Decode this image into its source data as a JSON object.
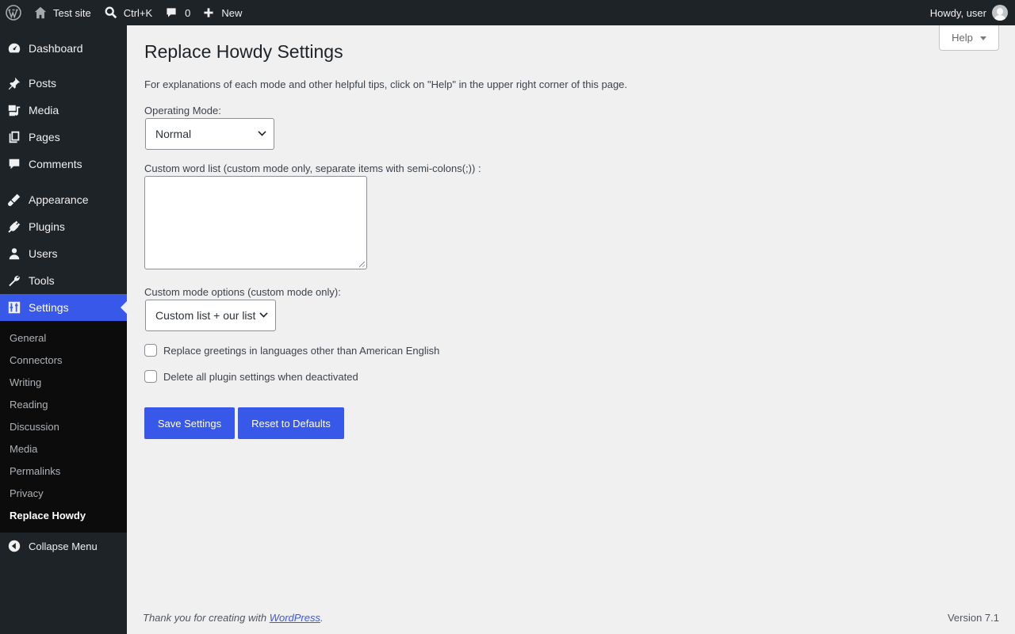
{
  "adminbar": {
    "site_name": "Test site",
    "search_shortcut": "Ctrl+K",
    "comments_count": "0",
    "new_label": "New",
    "howdy": "Howdy, user"
  },
  "sidebar": {
    "items": [
      {
        "label": "Dashboard",
        "icon": "dashboard-icon"
      },
      {
        "label": "Posts",
        "icon": "pin-icon"
      },
      {
        "label": "Media",
        "icon": "media-icon"
      },
      {
        "label": "Pages",
        "icon": "pages-icon"
      },
      {
        "label": "Comments",
        "icon": "comment-icon"
      },
      {
        "label": "Appearance",
        "icon": "brush-icon"
      },
      {
        "label": "Plugins",
        "icon": "plug-icon"
      },
      {
        "label": "Users",
        "icon": "user-icon"
      },
      {
        "label": "Tools",
        "icon": "wrench-icon"
      },
      {
        "label": "Settings",
        "icon": "settings-icon"
      }
    ],
    "submenu": [
      "General",
      "Connectors",
      "Writing",
      "Reading",
      "Discussion",
      "Media",
      "Permalinks",
      "Privacy",
      "Replace Howdy"
    ],
    "collapse_label": "Collapse Menu"
  },
  "main": {
    "help_label": "Help",
    "title": "Replace Howdy Settings",
    "intro": "For explanations of each mode and other helpful tips, click on \"Help\" in the upper right corner of this page.",
    "operating_mode_label": "Operating Mode:",
    "operating_mode_value": "Normal",
    "custom_word_list_label": "Custom word list (custom mode only, separate items with semi-colons(;)) :",
    "custom_word_list_value": "",
    "custom_mode_options_label": "Custom mode options (custom mode only):",
    "custom_mode_options_value": "Custom list + our list",
    "checkbox_languages_label": "Replace greetings in languages other than American English",
    "checkbox_languages_checked": false,
    "checkbox_delete_label": "Delete all plugin settings when deactivated",
    "checkbox_delete_checked": false,
    "save_label": "Save Settings",
    "reset_label": "Reset to Defaults"
  },
  "footer": {
    "thanks_prefix": "Thank you for creating with ",
    "thanks_link": "WordPress",
    "thanks_suffix": ".",
    "version": "Version 7.1"
  },
  "colors": {
    "accent": "#3858e9",
    "sidebar_bg": "#1d2327",
    "submenu_bg": "#0c0c0c",
    "page_bg": "#f0f0f1"
  }
}
